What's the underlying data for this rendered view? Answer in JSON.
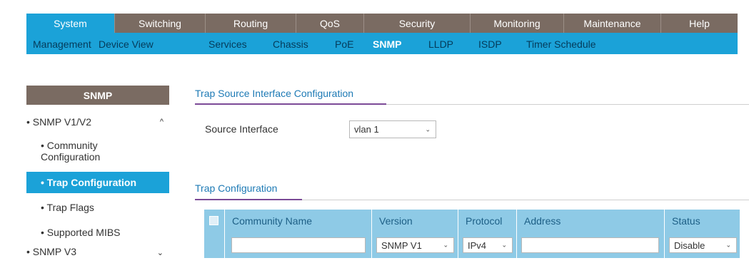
{
  "top_tabs": [
    "System",
    "Switching",
    "Routing",
    "QoS",
    "Security",
    "Monitoring",
    "Maintenance",
    "Help"
  ],
  "sub_nav": [
    "Management",
    "Device View",
    "Services",
    "Chassis",
    "PoE",
    "SNMP",
    "LLDP",
    "ISDP",
    "Timer Schedule"
  ],
  "sidebar": {
    "header": "SNMP",
    "items": [
      {
        "label": "• SNMP V1/V2"
      },
      {
        "label": "• Community\nConfiguration"
      },
      {
        "label": "• Trap Configuration"
      },
      {
        "label": "• Trap Flags"
      },
      {
        "label": "• Supported MIBS"
      },
      {
        "label": "• SNMP V3"
      }
    ],
    "chevrons": {
      "up": "^",
      "down": "⌄"
    }
  },
  "trap_source": {
    "title": "Trap Source Interface Configuration",
    "source_label": "Source Interface",
    "source_value": "vlan 1"
  },
  "trap_config": {
    "title": "Trap Configuration",
    "columns": [
      "Community Name",
      "Version",
      "Protocol",
      "Address",
      "Status"
    ],
    "row": {
      "community_name": "",
      "version": "SNMP V1",
      "protocol": "IPv4",
      "address": "",
      "status": "Disable"
    }
  },
  "colors": {
    "active_tab": "#1ba2d8",
    "tab_bg": "#7a6b62",
    "table_bg": "#8ecae6",
    "accent_line": "#7b4a97"
  }
}
